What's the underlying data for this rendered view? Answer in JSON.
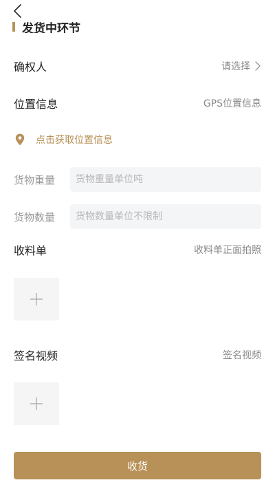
{
  "header": {
    "back_icon": "chevron-left-icon",
    "section_title": "发货中环节"
  },
  "confirmer": {
    "label": "确权人",
    "value": "请选择",
    "icon": "chevron-right-icon"
  },
  "location": {
    "label": "位置信息",
    "value": "GPS位置信息",
    "action_label": "点击获取位置信息",
    "action_icon": "location-pin-icon"
  },
  "weight": {
    "label": "货物重量",
    "placeholder": "货物重量单位吨",
    "value": ""
  },
  "quantity": {
    "label": "货物数量",
    "placeholder": "货物数量单位不限制",
    "value": ""
  },
  "receipt": {
    "label": "收料单",
    "hint": "收料单正面拍照",
    "upload_icon": "plus-icon"
  },
  "signature_video": {
    "label": "签名视频",
    "hint": "签名视频",
    "upload_icon": "plus-icon"
  },
  "submit": {
    "label": "收货"
  },
  "colors": {
    "accent": "#b89158",
    "input_bg": "#f4f5f7",
    "upload_bg": "#f5f5f5",
    "muted_text": "#888888"
  }
}
